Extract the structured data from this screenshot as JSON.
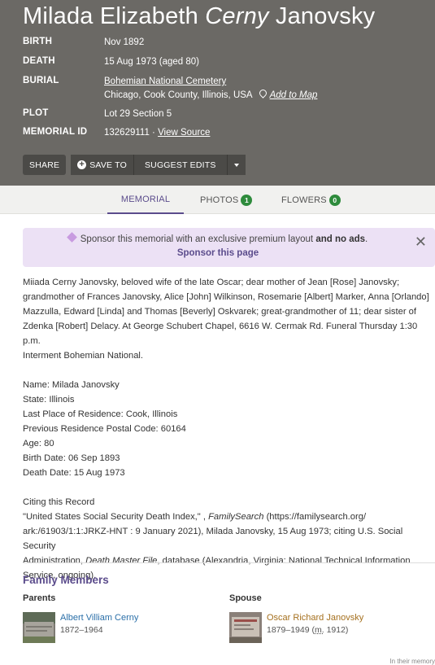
{
  "person": {
    "first_names": "Milada Elizabeth",
    "maiden": "Cerny",
    "surname": "Janovsky"
  },
  "facts": {
    "birth_label": "BIRTH",
    "birth_value": "Nov 1892",
    "death_label": "DEATH",
    "death_value": "15 Aug 1973 (aged 80)",
    "burial_label": "BURIAL",
    "burial_cemetery": "Bohemian National Cemetery",
    "burial_location": "Chicago, Cook County, Illinois, USA",
    "add_to_map": "Add to Map",
    "plot_label": "PLOT",
    "plot_value": "Lot 29 Section 5",
    "memorial_id_label": "MEMORIAL ID",
    "memorial_id_value": "132629111 · ",
    "view_source": "View Source"
  },
  "actions": {
    "share": "SHARE",
    "save_to": "SAVE TO",
    "suggest_edits": "SUGGEST EDITS"
  },
  "tabs": {
    "memorial": "MEMORIAL",
    "photos": "PHOTOS",
    "photos_count": "1",
    "flowers": "FLOWERS",
    "flowers_count": "0"
  },
  "sponsor": {
    "text_before": "Sponsor this memorial with an exclusive premium layout ",
    "text_bold": "and no ads",
    "text_after": ".",
    "link": "Sponsor this page"
  },
  "bio": {
    "obit_lines": [
      "Miiada Cerny Janovsky, beloved wife of the late Oscar; dear mother of Jean [Rose] Janovsky;",
      "grandmother of Frances Janovsky, Alice [John] Wilkinson, Rosemarie [Albert] Marker, Anna [Orlando]",
      "Mazzulla, Edward [Linda] and Thomas [Beverly] Oskvarek; great-grandmother of 11; dear sister of",
      "Zdenka [Robert] Delacy. At George Schubert Chapel, 6616 W. Cermak Rd. Funeral Thursday 1:30 p.m.",
      "Interment Bohemian National."
    ],
    "record_lines": [
      "Name: Milada Janovsky",
      "State: Illinois",
      "Last Place of Residence: Cook, Illinois",
      "Previous Residence Postal Code: 60164",
      "Age: 80",
      "Birth Date: 06 Sep 1893",
      "Death Date: 15 Aug 1973"
    ],
    "citing_title": "Citing this Record",
    "citing_1a": "\"United States Social Security Death Index,\" , ",
    "citing_1b": "FamilySearch",
    "citing_1c": " (https://familysearch.org/",
    "citing_2": "ark:/61903/1:1:JRKZ-HNT : 9 January 2021), Milada Janovsky, 15 Aug 1973; citing U.S. Social Security",
    "citing_3a": "Administration, ",
    "citing_3b": "Death Master File",
    "citing_3c": ", database (Alexandria, Virginia: National Technical Information",
    "citing_4": "Service, ongoing)."
  },
  "family": {
    "title": "Family Members",
    "parents_label": "Parents",
    "spouse_label": "Spouse",
    "parent_name": "Albert Villiam Cerny",
    "parent_dates": "1872–1964",
    "spouse_name": "Oscar Richard Janovsky",
    "spouse_dates": "1879–1949 (",
    "spouse_m": "m.",
    "spouse_year": " 1912)"
  },
  "footnote": "In their memory",
  "colors": {
    "header_bg": "#6b6965",
    "accent": "#5b4c8c",
    "link_blue": "#2a6fa8",
    "link_gold": "#a5701e",
    "badge_green": "#2e8b3c",
    "sponsor_bg": "#ece1f5"
  }
}
